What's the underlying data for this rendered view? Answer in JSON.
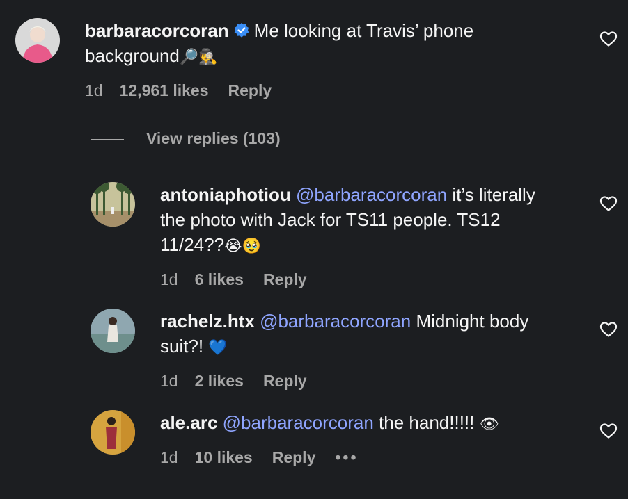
{
  "main_comment": {
    "username": "barbaracorcoran",
    "text": "Me looking at Travis’ phone",
    "text_line2": "background",
    "emoji": "🔎🕵",
    "time": "1d",
    "likes": "12,961 likes",
    "reply": "Reply"
  },
  "view_replies": "View replies (103)",
  "replies": [
    {
      "username": "antoniaphotiou",
      "mention": "@barbaracorcoran",
      "text_a": "it’s literally",
      "text_b": "the photo with Jack for TS11 people. TS12",
      "text_c": "11/24??",
      "emoji": "😭🥹",
      "time": "1d",
      "likes": "6 likes",
      "reply": "Reply"
    },
    {
      "username": "rachelz.htx",
      "mention": "@barbaracorcoran",
      "text_a": "Midnight body",
      "text_b": "suit?!",
      "emoji": "💙",
      "time": "1d",
      "likes": "2 likes",
      "reply": "Reply"
    },
    {
      "username": "ale.arc",
      "mention": "@barbaracorcoran",
      "text_a": "the hand!!!!!",
      "emoji": "👁",
      "time": "1d",
      "likes": "10 likes",
      "reply": "Reply",
      "more": "•••"
    }
  ],
  "icons": {
    "heart": "heart-icon",
    "verified": "verified-badge-icon",
    "more": "more-options-icon"
  },
  "colors": {
    "background": "#1c1e21",
    "mention": "#8fa5ff",
    "verified": "#3a8ef6",
    "muted": "#a8a8a8"
  }
}
